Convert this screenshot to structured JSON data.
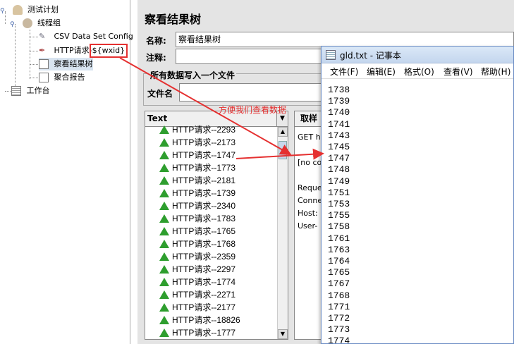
{
  "tree": {
    "test_plan": "测试计划",
    "thread_group": "线程组",
    "csv": "CSV Data Set Config",
    "http_prefix": "HTTP请求-",
    "http_var": "${wxid}",
    "view_tree": "察看结果树",
    "aggregate": "聚合报告",
    "workbench": "工作台"
  },
  "main": {
    "title": "察看结果树",
    "name_label": "名称:",
    "name_value": "察看结果树",
    "comment_label": "注释:",
    "write_all": "所有数据写入一个文件",
    "filename_label": "文件名"
  },
  "list": {
    "header": "Text",
    "combo_arrow": "▼",
    "items": [
      "HTTP请求--2293",
      "HTTP请求--2173",
      "HTTP请求--1747",
      "HTTP请求--1773",
      "HTTP请求--2181",
      "HTTP请求--1739",
      "HTTP请求--2340",
      "HTTP请求--1783",
      "HTTP请求--1765",
      "HTTP请求--1768",
      "HTTP请求--2359",
      "HTTP请求--2297",
      "HTTP请求--1774",
      "HTTP请求--2271",
      "HTTP请求--2177",
      "HTTP请求--18826",
      "HTTP请求--1777"
    ]
  },
  "sample": {
    "tab_label": "取样",
    "lines": [
      "GET h",
      "[no co",
      "Reque",
      "Conne",
      "Host:",
      "User-"
    ]
  },
  "annotation": "方便我们查看数据",
  "notepad": {
    "title": "gld.txt - 记事本",
    "menus": [
      "文件(F)",
      "编辑(E)",
      "格式(O)",
      "查看(V)",
      "帮助(H)"
    ],
    "lines": [
      "1738",
      "1739",
      "1740",
      "1741",
      "1743",
      "1745",
      "1747",
      "1748",
      "1749",
      "1751",
      "1753",
      "1755",
      "1758",
      "1761",
      "1763",
      "1764",
      "1765",
      "1767",
      "1768",
      "1771",
      "1772",
      "1773",
      "1774"
    ]
  },
  "colors": {
    "arrow": "#e53030",
    "tri": "#2e9e2e"
  }
}
